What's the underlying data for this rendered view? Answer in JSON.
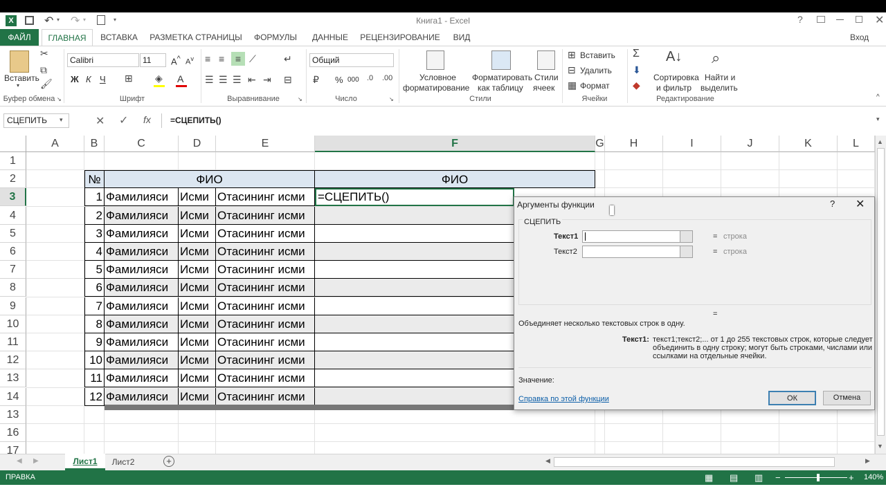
{
  "title": {
    "app_title": "Книга1 - Excel",
    "user": "Вход"
  },
  "tabs": [
    "ФАЙЛ",
    "ГЛАВНАЯ",
    "ВСТАВКА",
    "РАЗМЕТКА СТРАНИЦЫ",
    "ФОРМУЛЫ",
    "ДАННЫЕ",
    "РЕЦЕНЗИРОВАНИЕ",
    "ВИД"
  ],
  "ribbon": {
    "paste": "Вставить",
    "font_name": "Calibri",
    "font_size": "11",
    "bold": "Ж",
    "italic": "К",
    "underline": "Ч",
    "number_format": "Общий",
    "percent": "%",
    "thousands": "000",
    "cond_format_1": "Условное",
    "cond_format_2": "форматирование",
    "fmt_table_1": "Форматировать",
    "fmt_table_2": "как таблицу",
    "styles_1": "Стили",
    "styles_2": "ячеек",
    "insert": "Вставить",
    "delete": "Удалить",
    "format": "Формат",
    "sort_1": "Сортировка",
    "sort_2": "и фильтр",
    "find_1": "Найти и",
    "find_2": "выделить",
    "groups": [
      "Буфер обмена",
      "Шрифт",
      "Выравнивание",
      "Число",
      "Стили",
      "Ячейки",
      "Редактирование"
    ]
  },
  "formula_bar": {
    "name_box": "СЦЕПИТЬ",
    "formula": "=СЦЕПИТЬ()"
  },
  "columns": [
    "A",
    "B",
    "C",
    "D",
    "E",
    "F",
    "G",
    "H",
    "I",
    "J",
    "K",
    "L"
  ],
  "rows": [
    "1",
    "2",
    "3",
    "4",
    "5",
    "6",
    "7",
    "8",
    "9",
    "10",
    "11",
    "12",
    "13",
    "14",
    "13",
    "16",
    "17"
  ],
  "table": {
    "header_num": "№",
    "header_fio": "ФИО",
    "header_f": "ФИО",
    "active_formula": "=СЦЕПИТЬ()",
    "rows": [
      [
        "1",
        "Фамилияси",
        "Исми",
        "Отасининг исми"
      ],
      [
        "2",
        "Фамилияси",
        "Исми",
        "Отасининг исми"
      ],
      [
        "3",
        "Фамилияси",
        "Исми",
        "Отасининг исми"
      ],
      [
        "4",
        "Фамилияси",
        "Исми",
        "Отасининг исми"
      ],
      [
        "5",
        "Фамилияси",
        "Исми",
        "Отасининг исми"
      ],
      [
        "6",
        "Фамилияси",
        "Исми",
        "Отасининг исми"
      ],
      [
        "7",
        "Фамилияси",
        "Исми",
        "Отасининг исми"
      ],
      [
        "8",
        "Фамилияси",
        "Исми",
        "Отасининг исми"
      ],
      [
        "9",
        "Фамилияси",
        "Исми",
        "Отасининг исми"
      ],
      [
        "10",
        "Фамилияси",
        "Исми",
        "Отасининг исми"
      ],
      [
        "11",
        "Фамилияси",
        "Исми",
        "Отасининг исми"
      ],
      [
        "12",
        "Фамилияси",
        "Исми",
        "Отасининг исми"
      ]
    ]
  },
  "sheets": [
    "Лист1",
    "Лист2"
  ],
  "status": {
    "mode": "ПРАВКА",
    "zoom": "140%"
  },
  "dialog": {
    "title": "Аргументы функции",
    "help_q": "?",
    "func_name": "СЦЕПИТЬ",
    "arg1": "Текст1",
    "arg2": "Текст2",
    "eq": "=",
    "hint": "строка",
    "description": "Объединяет несколько текстовых строк в одну.",
    "arg_label": "Текст1:",
    "arg_desc": "текст1;текст2;... от 1 до 255 текстовых строк, которые следует объединить в одну строку; могут быть строками, числами или ссылками на отдельные ячейки.",
    "value_label": "Значение:",
    "help_link": "Справка по этой функции",
    "ok": "ОК",
    "cancel": "Отмена"
  },
  "colors": {
    "accent": "#217346",
    "header_fill": "#dce6f1",
    "dialog_bg": "#f0f0f0"
  }
}
